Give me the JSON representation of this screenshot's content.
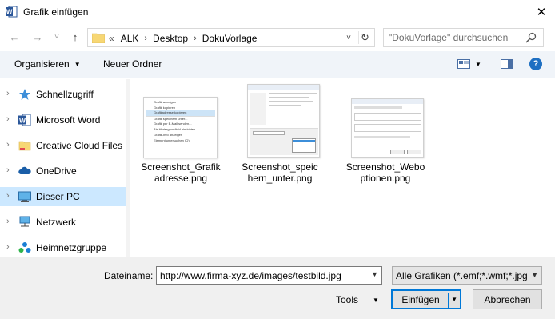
{
  "window": {
    "title": "Grafik einfügen",
    "close_glyph": "✕"
  },
  "nav": {
    "back_glyph": "←",
    "forward_glyph": "→",
    "recent_glyph": "˅",
    "up_glyph": "↑",
    "breadcrumb": [
      "«",
      "ALK",
      "Desktop",
      "DokuVorlage"
    ],
    "breadcrumb_dropdown_glyph": "˅",
    "refresh_glyph": "↻",
    "search_placeholder": "\"DokuVorlage\" durchsuchen"
  },
  "toolbar": {
    "organize_label": "Organisieren",
    "new_folder_label": "Neuer Ordner",
    "caret": "▼",
    "help_glyph": "?"
  },
  "sidebar": {
    "items": [
      {
        "label": "Schnellzugriff",
        "icon": "star-icon"
      },
      {
        "label": "Microsoft Word",
        "icon": "word-icon"
      },
      {
        "label": "Creative Cloud Files",
        "icon": "folder-icon"
      },
      {
        "label": "OneDrive",
        "icon": "cloud-icon"
      },
      {
        "label": "Dieser PC",
        "icon": "pc-icon",
        "selected": true
      },
      {
        "label": "Netzwerk",
        "icon": "network-icon"
      },
      {
        "label": "Heimnetzgruppe",
        "icon": "homegroup-icon"
      }
    ],
    "chevron": "›"
  },
  "files": [
    {
      "name": "Screenshot_Grafikadresse.png",
      "menu_lines": [
        "Grafik anzeigen",
        "Grafik kopieren",
        "Grafikadresse kopieren",
        "Grafik speichern unter...",
        "Grafik per E-Mail senden...",
        "Als Hintergrundbild einrichten...",
        "Grafik-Info anzeigen",
        "Element untersuchen (Q)"
      ]
    },
    {
      "name": "Screenshot_speichern_unter.png"
    },
    {
      "name": "Screenshot_Weboptionen.png"
    }
  ],
  "bottom": {
    "filename_label": "Dateiname:",
    "filename_value": "http://www.firma-xyz.de/images/testbild.jpg",
    "filter_value": "Alle Grafiken (*.emf;*.wmf;*.jpg",
    "tools_label": "Tools",
    "insert_label": "Einfügen",
    "cancel_label": "Abbrechen",
    "caret": "▼"
  },
  "colors": {
    "selection": "#cce8ff",
    "toolbar_bg": "#f0f4f9",
    "accent": "#0078d7",
    "word_blue": "#2b579a"
  }
}
